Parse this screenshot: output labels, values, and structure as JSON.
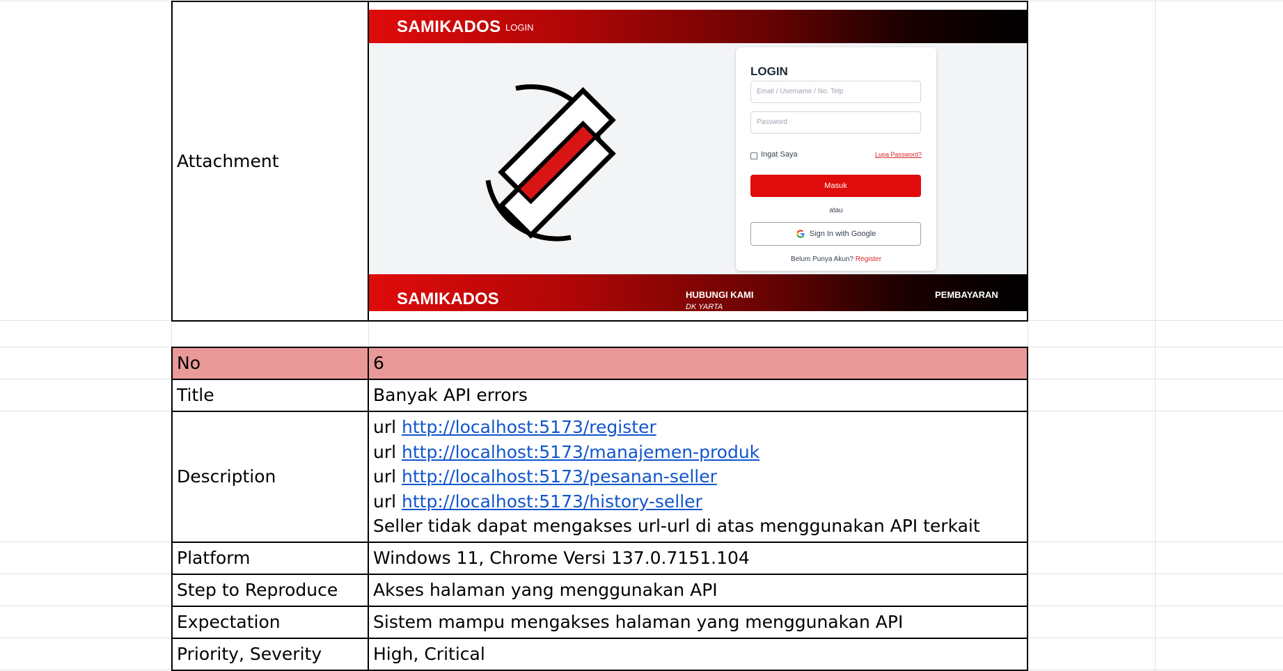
{
  "attachment": {
    "label": "Attachment",
    "screenshot": {
      "brand": "SAMIKADOS",
      "nav_login": "LOGIN",
      "login_card": {
        "title": "LOGIN",
        "username_placeholder": "Email / Username / No. Telp",
        "password_placeholder": "Password",
        "remember_label": "Ingat Saya",
        "forgot_link": "Lupa Password?",
        "submit_label": "Masuk",
        "divider_text": "atau",
        "google_label": "Sign In with Google",
        "no_account_text": "Belum Punya Akun?",
        "register_link": "Register"
      },
      "footer": {
        "brand": "SAMIKADOS",
        "contact_heading": "HUBUNGI KAMI",
        "city": "DK YARTA",
        "payment_heading": "PEMBAYARAN"
      },
      "colors": {
        "brand_red": "#e00b0b",
        "logo_red": "#d91414"
      }
    }
  },
  "bug": {
    "rows": [
      {
        "label": "No",
        "value": "6"
      },
      {
        "label": "Title",
        "value": "Banyak API errors"
      },
      {
        "label": "Description"
      },
      {
        "label": "Platform",
        "value": "Windows 11, Chrome Versi 137.0.7151.104"
      },
      {
        "label": "Step to Reproduce",
        "value": "Akses halaman yang menggunakan API"
      },
      {
        "label": "Expectation",
        "value": "Sistem mampu mengakses halaman yang menggunakan API"
      },
      {
        "label": "Priority, Severity",
        "value": "High, Critical"
      }
    ],
    "description": {
      "urls": [
        {
          "prefix": "url",
          "link": "http://localhost:5173/register"
        },
        {
          "prefix": "url",
          "link": "http://localhost:5173/manajemen-produk"
        },
        {
          "prefix": "url",
          "link": "http://localhost:5173/pesanan-seller"
        },
        {
          "prefix": "url",
          "link": "http://localhost:5173/history-seller"
        }
      ],
      "summary": "Seller tidak dapat mengakses url-url di atas menggunakan API terkait"
    },
    "colors": {
      "header_row": "#ea9999",
      "link": "#1155cc"
    }
  }
}
